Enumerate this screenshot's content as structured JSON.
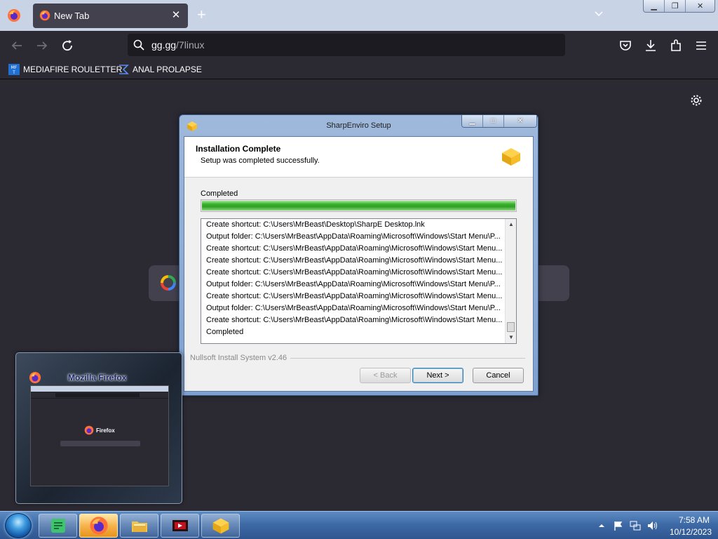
{
  "browser": {
    "tab": {
      "title": "New Tab"
    },
    "url": {
      "host": "gg.gg",
      "path": "/7linux"
    },
    "bookmarks": [
      {
        "label": "MEDIAFIRE ROULETTER",
        "icon": "mediafire-icon"
      },
      {
        "label": "ANAL PROLAPSE",
        "icon": "sigma-icon"
      }
    ],
    "new_tab_page": {
      "logo": "google-icon"
    }
  },
  "installer": {
    "window_title": "SharpEnviro Setup",
    "header_title": "Installation Complete",
    "header_subtitle": "Setup was completed successfully.",
    "status_label": "Completed",
    "progress": 1.0,
    "log": [
      "Create shortcut: C:\\Users\\MrBeast\\Desktop\\SharpE Desktop.lnk",
      "Output folder: C:\\Users\\MrBeast\\AppData\\Roaming\\Microsoft\\Windows\\Start Menu\\P...",
      "Create shortcut: C:\\Users\\MrBeast\\AppData\\Roaming\\Microsoft\\Windows\\Start Menu...",
      "Create shortcut: C:\\Users\\MrBeast\\AppData\\Roaming\\Microsoft\\Windows\\Start Menu...",
      "Create shortcut: C:\\Users\\MrBeast\\AppData\\Roaming\\Microsoft\\Windows\\Start Menu...",
      "Output folder: C:\\Users\\MrBeast\\AppData\\Roaming\\Microsoft\\Windows\\Start Menu\\P...",
      "Create shortcut: C:\\Users\\MrBeast\\AppData\\Roaming\\Microsoft\\Windows\\Start Menu...",
      "Output folder: C:\\Users\\MrBeast\\AppData\\Roaming\\Microsoft\\Windows\\Start Menu\\P...",
      "Create shortcut: C:\\Users\\MrBeast\\AppData\\Roaming\\Microsoft\\Windows\\Start Menu...",
      "Completed"
    ],
    "branding": "Nullsoft Install System v2.46",
    "buttons": {
      "back": "< Back",
      "next": "Next >",
      "cancel": "Cancel"
    }
  },
  "preview": {
    "title": "Mozilla Firefox",
    "logo_text": "Firefox"
  },
  "taskbar": {
    "items": [
      "sticky-notes-icon",
      "firefox-icon",
      "file-explorer-icon",
      "media-app-icon",
      "sharpenviro-setup-icon"
    ],
    "clock": {
      "time": "7:58 AM",
      "date": "10/12/2023"
    }
  },
  "colors": {
    "browser_bg": "#2b2a33",
    "tabbar_bg": "#c8d3e6",
    "progress_green": "#37b22b",
    "taskbar_blue": "#3e6aa6"
  }
}
